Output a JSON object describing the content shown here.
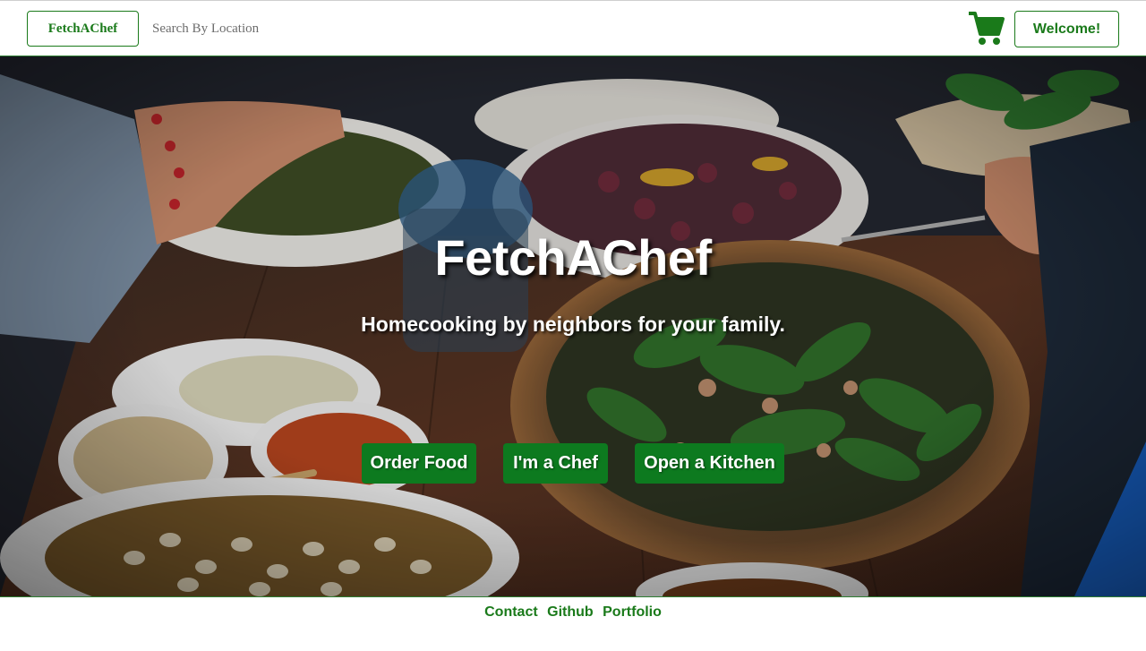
{
  "navbar": {
    "brand_label": "FetchAChef",
    "search_placeholder": "Search By Location",
    "cart_icon": "shopping-cart-icon",
    "welcome_label": "Welcome!"
  },
  "hero": {
    "title": "FetchAChef",
    "subtitle": "Homecooking by neighbors for your family.",
    "buttons": [
      {
        "label": "Order Food"
      },
      {
        "label": "I'm a Chef"
      },
      {
        "label": "Open a Kitchen"
      }
    ]
  },
  "footer": {
    "links": [
      {
        "label": "Contact"
      },
      {
        "label": "Github"
      },
      {
        "label": "Portfolio"
      }
    ]
  },
  "colors": {
    "brand_green": "#1a7a1a",
    "button_green": "#0d7a1f",
    "hero_text": "#ffffff"
  }
}
